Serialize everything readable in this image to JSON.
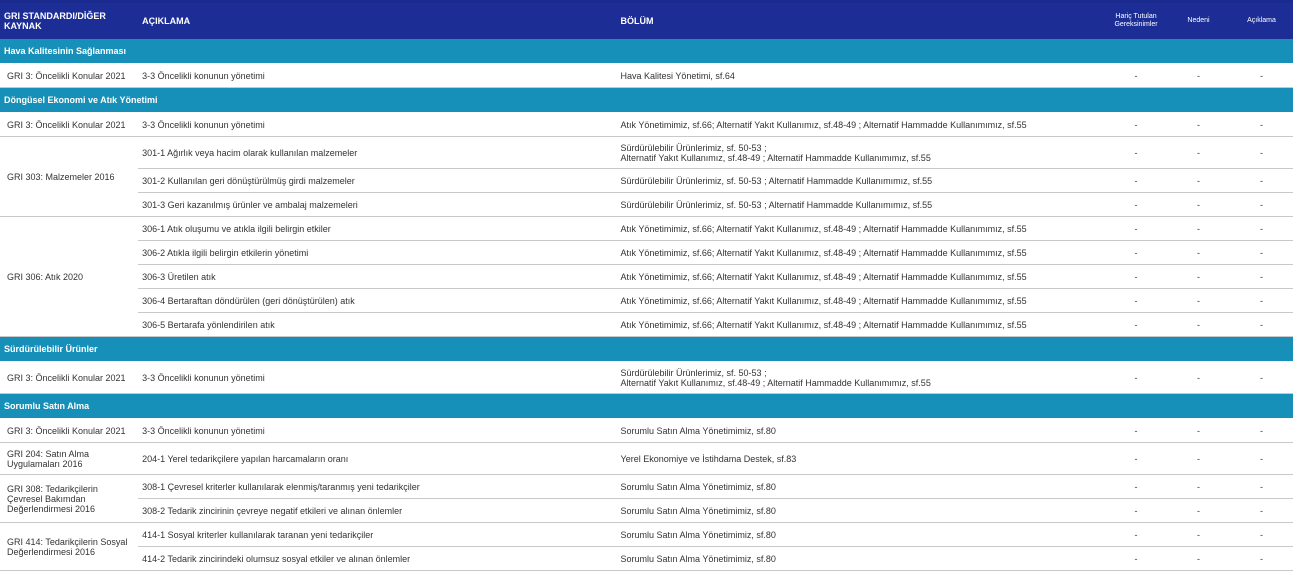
{
  "header": {
    "gri": "GRI STANDARDI/DİĞER KAYNAK",
    "aciklama": "AÇIKLAMA",
    "bolum": "BÖLÜM",
    "haric": "Hariç Tutulan Gereksinimler",
    "nedeni": "Nedeni",
    "aciklama2": "Açıklama"
  },
  "dash": "-",
  "sections": [
    {
      "title": "Hava Kalitesinin Sağlanması",
      "rows": [
        {
          "gri": "GRI 3: Öncelikli Konular 2021",
          "desc": "3-3 Öncelikli konunun yönetimi",
          "ref": "Hava Kalitesi Yönetimi, sf.64"
        }
      ]
    },
    {
      "title": "Döngüsel Ekonomi ve Atık Yönetimi",
      "rows": [
        {
          "gri": "GRI 3: Öncelikli Konular 2021",
          "desc": "3-3 Öncelikli konunun yönetimi",
          "ref": "Atık Yönetimimiz, sf.66; Alternatif Yakıt Kullanımız, sf.48-49 ; Alternatif Hammadde Kullanımımız, sf.55"
        },
        {
          "gri": "GRI 303: Malzemeler 2016",
          "desc": "301-1 Ağırlık veya hacim olarak kullanılan malzemeler",
          "ref": "Sürdürülebilir Ürünlerimiz, sf. 50-53 ;",
          "ref2": "Alternatif Yakıt Kullanımız, sf.48-49 ; Alternatif Hammadde Kullanımımız, sf.55"
        },
        {
          "desc": "301-2 Kullanılan geri dönüştürülmüş girdi malzemeler",
          "ref": "Sürdürülebilir Ürünlerimiz, sf. 50-53 ; Alternatif Hammadde Kullanımımız, sf.55"
        },
        {
          "desc": "301-3 Geri kazanılmış ürünler ve ambalaj malzemeleri",
          "ref": "Sürdürülebilir Ürünlerimiz, sf. 50-53 ; Alternatif Hammadde Kullanımımız, sf.55"
        },
        {
          "gri": "GRI 306: Atık 2020",
          "desc": "306-1 Atık oluşumu ve atıkla ilgili belirgin etkiler",
          "ref": "Atık Yönetimimiz, sf.66; Alternatif Yakıt Kullanımız, sf.48-49 ; Alternatif Hammadde Kullanımımız, sf.55"
        },
        {
          "desc": "306-2 Atıkla ilgili belirgin etkilerin yönetimi",
          "ref": "Atık Yönetimimiz, sf.66; Alternatif Yakıt Kullanımız, sf.48-49 ; Alternatif Hammadde Kullanımımız, sf.55"
        },
        {
          "desc": "306-3 Üretilen atık",
          "ref": "Atık Yönetimimiz, sf.66; Alternatif Yakıt Kullanımız, sf.48-49 ; Alternatif Hammadde Kullanımımız, sf.55"
        },
        {
          "desc": "306-4 Bertaraftan döndürülen (geri dönüştürülen) atık",
          "ref": "Atık Yönetimimiz, sf.66; Alternatif Yakıt Kullanımız, sf.48-49 ; Alternatif Hammadde Kullanımımız, sf.55"
        },
        {
          "desc": "306-5 Bertarafa yönlendirilen atık",
          "ref": "Atık Yönetimimiz, sf.66; Alternatif Yakıt Kullanımız, sf.48-49 ; Alternatif Hammadde Kullanımımız, sf.55"
        }
      ]
    },
    {
      "title": "Sürdürülebilir Ürünler",
      "rows": [
        {
          "gri": "GRI 3: Öncelikli Konular 2021",
          "desc": "3-3 Öncelikli konunun yönetimi",
          "ref": "Sürdürülebilir Ürünlerimiz, sf. 50-53 ;",
          "ref2": "Alternatif Yakıt Kullanımız, sf.48-49 ; Alternatif Hammadde Kullanımımız, sf.55"
        }
      ]
    },
    {
      "title": "Sorumlu Satın Alma",
      "rows": [
        {
          "gri": "GRI 3: Öncelikli Konular 2021",
          "desc": "3-3 Öncelikli konunun yönetimi",
          "ref": "Sorumlu Satın Alma Yönetimimiz, sf.80"
        },
        {
          "gri": "GRI 204: Satın Alma Uygulamaları 2016",
          "desc": "204-1 Yerel tedarikçilere yapılan harcamaların oranı",
          "ref": "Yerel Ekonomiye ve İstihdama Destek, sf.83"
        },
        {
          "gri": "GRI 308: Tedarikçilerin Çevresel Bakımdan Değerlendirmesi 2016",
          "desc": "308-1 Çevresel kriterler kullanılarak elenmiş/taranmış yeni tedarikçiler",
          "ref": "Sorumlu Satın Alma Yönetimimiz, sf.80"
        },
        {
          "desc": "308-2 Tedarik zincirinin çevreye negatif etkileri ve alınan önlemler",
          "ref": "Sorumlu Satın Alma Yönetimimiz, sf.80"
        },
        {
          "gri": "GRI 414: Tedarikçilerin Sosyal Değerlendirmesi 2016",
          "desc": "414-1 Sosyal kriterler kullanılarak taranan yeni tedarikçiler",
          "ref": "Sorumlu Satın Alma Yönetimimiz, sf.80"
        },
        {
          "desc": "414-2 Tedarik zincirindeki olumsuz sosyal etkiler ve alınan önlemler",
          "ref": "Sorumlu Satın Alma Yönetimimiz, sf.80"
        }
      ]
    }
  ]
}
